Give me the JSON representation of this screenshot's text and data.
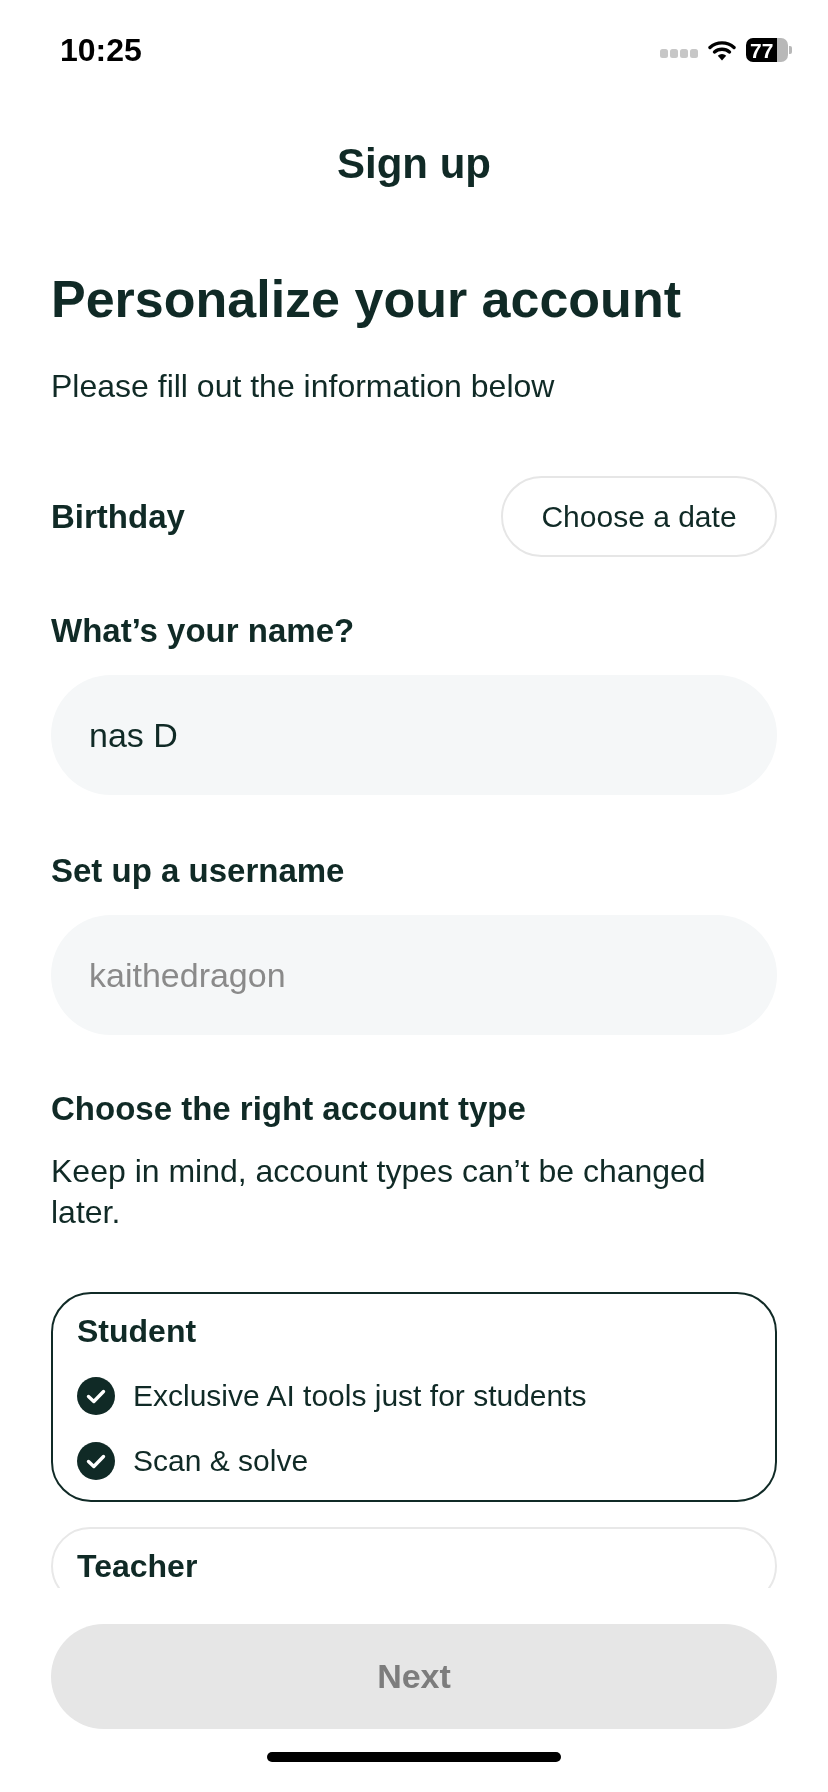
{
  "status_bar": {
    "time": "10:25",
    "battery": "77"
  },
  "nav": {
    "title": "Sign up"
  },
  "header": {
    "title": "Personalize your account",
    "subtitle": "Please fill out the information below"
  },
  "birthday": {
    "label": "Birthday",
    "button": "Choose a date"
  },
  "name_field": {
    "label": "What’s your name?",
    "value": "nas D"
  },
  "username_field": {
    "label": "Set up a username",
    "placeholder": "kaithedragon"
  },
  "account_type": {
    "title": "Choose the right account type",
    "note": "Keep in mind, account types can’t be changed later.",
    "options": [
      {
        "name": "Student",
        "selected": true,
        "features": [
          "Exclusive AI tools just for students",
          "Scan & solve"
        ]
      },
      {
        "name": "Teacher",
        "selected": false
      }
    ]
  },
  "next_button": {
    "label": "Next",
    "disabled": true
  }
}
